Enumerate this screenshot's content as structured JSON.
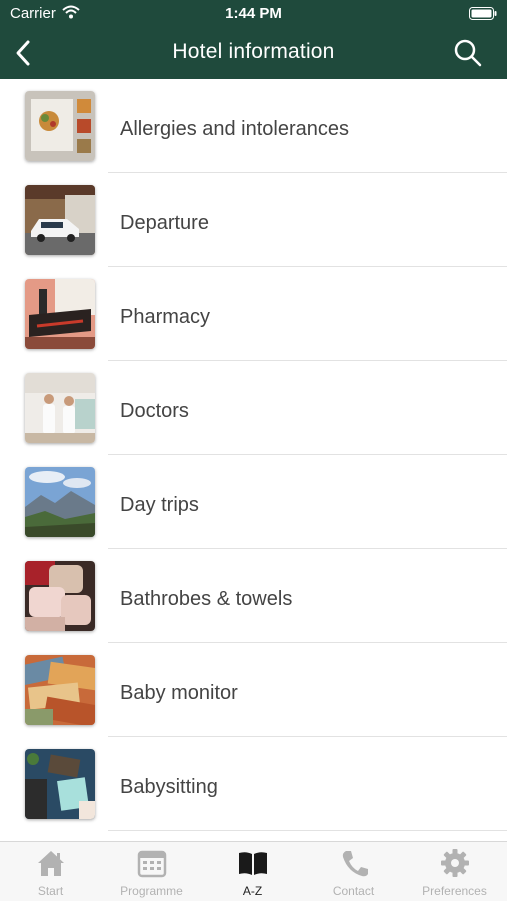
{
  "status_bar": {
    "carrier": "Carrier",
    "time": "1:44 PM"
  },
  "navbar": {
    "title": "Hotel information",
    "back_icon": "chevron-left-icon",
    "search_icon": "search-icon"
  },
  "colors": {
    "header_bg": "#1f4a3c",
    "tab_active": "#222222",
    "tab_inactive": "#b2b2b2"
  },
  "list": {
    "items": [
      {
        "label": "Allergies and intolerances",
        "image": "food plate photo"
      },
      {
        "label": "Departure",
        "image": "electric car photo"
      },
      {
        "label": "Pharmacy",
        "image": "Apotheke sign photo"
      },
      {
        "label": "Doctors",
        "image": "doctors photo"
      },
      {
        "label": "Day trips",
        "image": "mountain landscape photo"
      },
      {
        "label": "Bathrobes & towels",
        "image": "folded towels photo"
      },
      {
        "label": "Baby monitor",
        "image": "money notes photo"
      },
      {
        "label": "Babysitting",
        "image": "desk with notebook photo"
      }
    ]
  },
  "tabbar": {
    "tabs": [
      {
        "label": "Start",
        "icon": "home-icon",
        "active": false
      },
      {
        "label": "Programme",
        "icon": "calendar-icon",
        "active": false
      },
      {
        "label": "A-Z",
        "icon": "book-icon",
        "active": true
      },
      {
        "label": "Contact",
        "icon": "phone-icon",
        "active": false
      },
      {
        "label": "Preferences",
        "icon": "gear-icon",
        "active": false
      }
    ]
  }
}
